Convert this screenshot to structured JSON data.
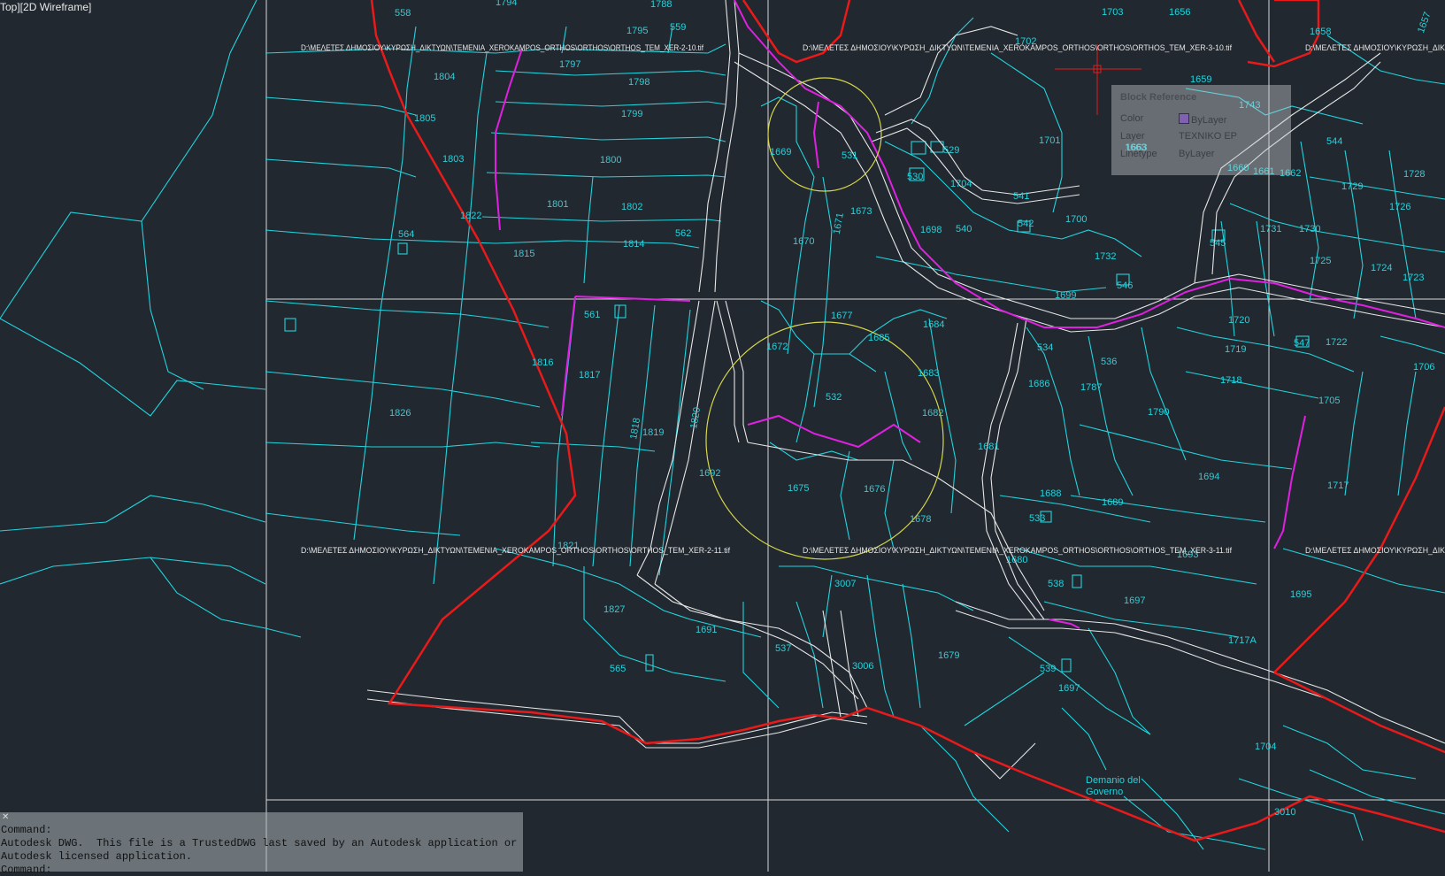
{
  "viewport": {
    "label": "Top][2D Wireframe]"
  },
  "raster_paths": [
    "D:\\ΜΕΛΕΤΕΣ ΔΗΜΟΣΙΟΥ\\ΚΥΡΩΣΗ_ΔΙΚΤΥΩΝ\\ΤΕΜΕΝΙΑ_XEROKAMPOS_ORTHOS\\ORTHOS\\ORTHOS_TEM_XER-2-10.tif",
    "D:\\ΜΕΛΕΤΕΣ ΔΗΜΟΣΙΟΥ\\ΚΥΡΩΣΗ_ΔΙΚΤΥΩΝ\\ΤΕΜΕΝΙΑ_XEROKAMPOS_ORTHOS\\ORTHOS\\ORTHOS_TEM_XER-3-10.tif",
    "D:\\ΜΕΛΕΤΕΣ ΔΗΜΟΣΙΟΥ\\ΚΥΡΩΣΗ_ΔΙΚ",
    "D:\\ΜΕΛΕΤΕΣ ΔΗΜΟΣΙΟΥ\\ΚΥΡΩΣΗ_ΔΙΚΤΥΩΝ\\ΤΕΜΕΝΙΑ_XEROKAMPOS_ORTHOS\\ORTHOS\\ORTHOS_TEM_XER-2-11.tif",
    "D:\\ΜΕΛΕΤΕΣ ΔΗΜΟΣΙΟΥ\\ΚΥΡΩΣΗ_ΔΙΚΤΥΩΝ\\ΤΕΜΕΝΙΑ_XEROKAMPOS_ORTHOS\\ORTHOS\\ORTHOS_TEM_XER-3-11.tif",
    "D:\\ΜΕΛΕΤΕΣ ΔΗΜΟΣΙΟΥ\\ΚΥΡΩΣΗ_ΔΙΚ"
  ],
  "parcels": [
    "558",
    "1794",
    "1788",
    "559",
    "1795",
    "1797",
    "1798",
    "1799",
    "1800",
    "1801",
    "1802",
    "1804",
    "1805",
    "1803",
    "1822",
    "564",
    "1815",
    "1814",
    "562",
    "561",
    "1816",
    "1817",
    "1826",
    "1818",
    "1819",
    "1820",
    "1692",
    "1675",
    "1676",
    "1678",
    "1672",
    "532",
    "1677",
    "1685",
    "1683",
    "1682",
    "1681",
    "1669",
    "531",
    "1673",
    "1670",
    "1671",
    "1703",
    "1656",
    "1702",
    "1701",
    "1659",
    "1743",
    "1663",
    "530",
    "529",
    "1704",
    "541",
    "1698",
    "540",
    "542",
    "1700",
    "1732",
    "546",
    "1699",
    "1658",
    "544",
    "1660",
    "1661",
    "1662",
    "1729",
    "1728",
    "1726",
    "1731",
    "1730",
    "545",
    "1725",
    "1724",
    "1723",
    "1720",
    "1719",
    "1718",
    "1722",
    "547",
    "1706",
    "1705",
    "1717",
    "534",
    "536",
    "1686",
    "1787",
    "1790",
    "1694",
    "1688",
    "1689",
    "533",
    "1684",
    "538",
    "1697",
    "1695",
    "3007",
    "1827",
    "1691",
    "565",
    "537",
    "3006",
    "1679",
    "539",
    "1697",
    "1717A",
    "1704",
    "3010",
    "1680",
    "1693",
    "1821",
    "1657",
    "1663"
  ],
  "area_label": "Demanio del\nGoverno",
  "tooltip": {
    "title": "Block Reference",
    "rows": [
      {
        "key": "Color",
        "value": "ByLayer"
      },
      {
        "key": "Layer",
        "value": "TEXNIKO EP"
      },
      {
        "key": "Linetype",
        "value": "ByLayer"
      }
    ]
  },
  "command_line": {
    "lines": [
      "Command:",
      "Autodesk DWG.  This file is a TrustedDWG last saved by an Autodesk application or",
      "Autodesk licensed application.",
      "Command:"
    ]
  },
  "colors": {
    "background": "#212830",
    "parcel_lines": "#22d3dc",
    "boundary": "#e81a1a",
    "road_lines": "#e6e6e6",
    "magenta": "#e020e0",
    "circle": "#d8d84a",
    "grid": "#d8d8d8"
  }
}
